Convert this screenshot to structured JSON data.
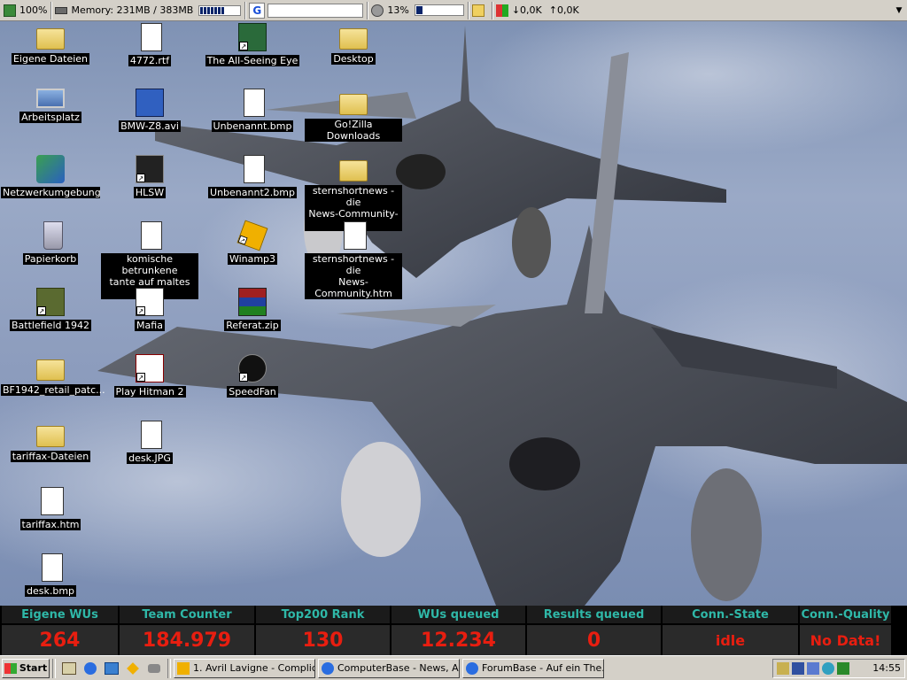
{
  "topbar": {
    "zoom": "100%",
    "memory_label": "Memory: 231MB / 383MB",
    "memory_fraction": 0.6,
    "search_logo": "G",
    "search_value": "",
    "cpu_label": "13%",
    "cpu_fraction": 0.13,
    "down_rate": "0,0K",
    "up_rate": "0,0K",
    "menu_arrow": "▼"
  },
  "desktop_icons": [
    {
      "label": "Eigene Dateien",
      "icon": "folder-docs-icon"
    },
    {
      "label": "4772.rtf",
      "icon": "rtf-document-icon"
    },
    {
      "label": "The All-Seeing Eye",
      "icon": "all-seeing-eye-icon"
    },
    {
      "label": "Desktop",
      "icon": "folder-icon"
    },
    {
      "label": "Arbeitsplatz",
      "icon": "computer-icon"
    },
    {
      "label": "BMW-Z8.avi",
      "icon": "video-file-icon"
    },
    {
      "label": "Unbenannt.bmp",
      "icon": "bmp-file-icon"
    },
    {
      "label": "Go!Zilla Downloads",
      "icon": "folder-icon"
    },
    {
      "label": "Netzwerkumgebung",
      "icon": "network-icon"
    },
    {
      "label": "HLSW",
      "icon": "hlsw-icon"
    },
    {
      "label": "Unbenannt2.bmp",
      "icon": "bmp-file-icon"
    },
    {
      "label": "sternshortnews - die\nNews-Community-D...",
      "icon": "folder-icon"
    },
    {
      "label": "Papierkorb",
      "icon": "recycle-bin-icon"
    },
    {
      "label": "komische betrunkene\ntante auf maltes g...",
      "icon": "text-file-icon"
    },
    {
      "label": "Winamp3",
      "icon": "winamp-icon"
    },
    {
      "label": "sternshortnews - die\nNews-Community.htm",
      "icon": "ie-html-icon"
    },
    {
      "label": "Battlefield 1942",
      "icon": "battlefield-icon"
    },
    {
      "label": "Mafia",
      "icon": "mafia-icon"
    },
    {
      "label": "Referat.zip",
      "icon": "winrar-zip-icon"
    },
    {
      "label": "BF1942_retail_patc...",
      "icon": "folder-icon"
    },
    {
      "label": "Play Hitman 2",
      "icon": "hitman-icon"
    },
    {
      "label": "SpeedFan",
      "icon": "speedfan-icon"
    },
    {
      "label": "tariffax-Dateien",
      "icon": "folder-icon"
    },
    {
      "label": "desk.JPG",
      "icon": "jpg-file-icon"
    },
    {
      "label": "tariffax.htm",
      "icon": "ie-html-icon"
    },
    {
      "label": "desk.bmp",
      "icon": "bmp-file-icon"
    }
  ],
  "stats": [
    {
      "header": "Eigene WUs",
      "value": "264"
    },
    {
      "header": "Team Counter",
      "value": "184.979"
    },
    {
      "header": "Top200 Rank",
      "value": "130"
    },
    {
      "header": "WUs queued",
      "value": "12.234"
    },
    {
      "header": "Results queued",
      "value": "0"
    },
    {
      "header": "Conn.-State",
      "value": "idle"
    },
    {
      "header": "Conn.-Quality",
      "value": "No Data!"
    }
  ],
  "taskbar": {
    "start_label": "Start",
    "quick_launch": [
      "show-desktop-icon",
      "ie-icon",
      "outlook-icon",
      "winamp-quick-icon",
      "media-icon"
    ],
    "tasks": [
      {
        "label": "1. Avril Lavigne - Complic...",
        "icon": "winamp-icon"
      },
      {
        "label": "ComputerBase - News, Ar...",
        "icon": "ie-icon"
      },
      {
        "label": "ForumBase - Auf ein The...",
        "icon": "ie-icon"
      }
    ],
    "tray_icons": [
      "volume-icon",
      "display-icon",
      "network-tray-icon",
      "globe-icon",
      "tree-icon"
    ],
    "clock": "14:55"
  }
}
